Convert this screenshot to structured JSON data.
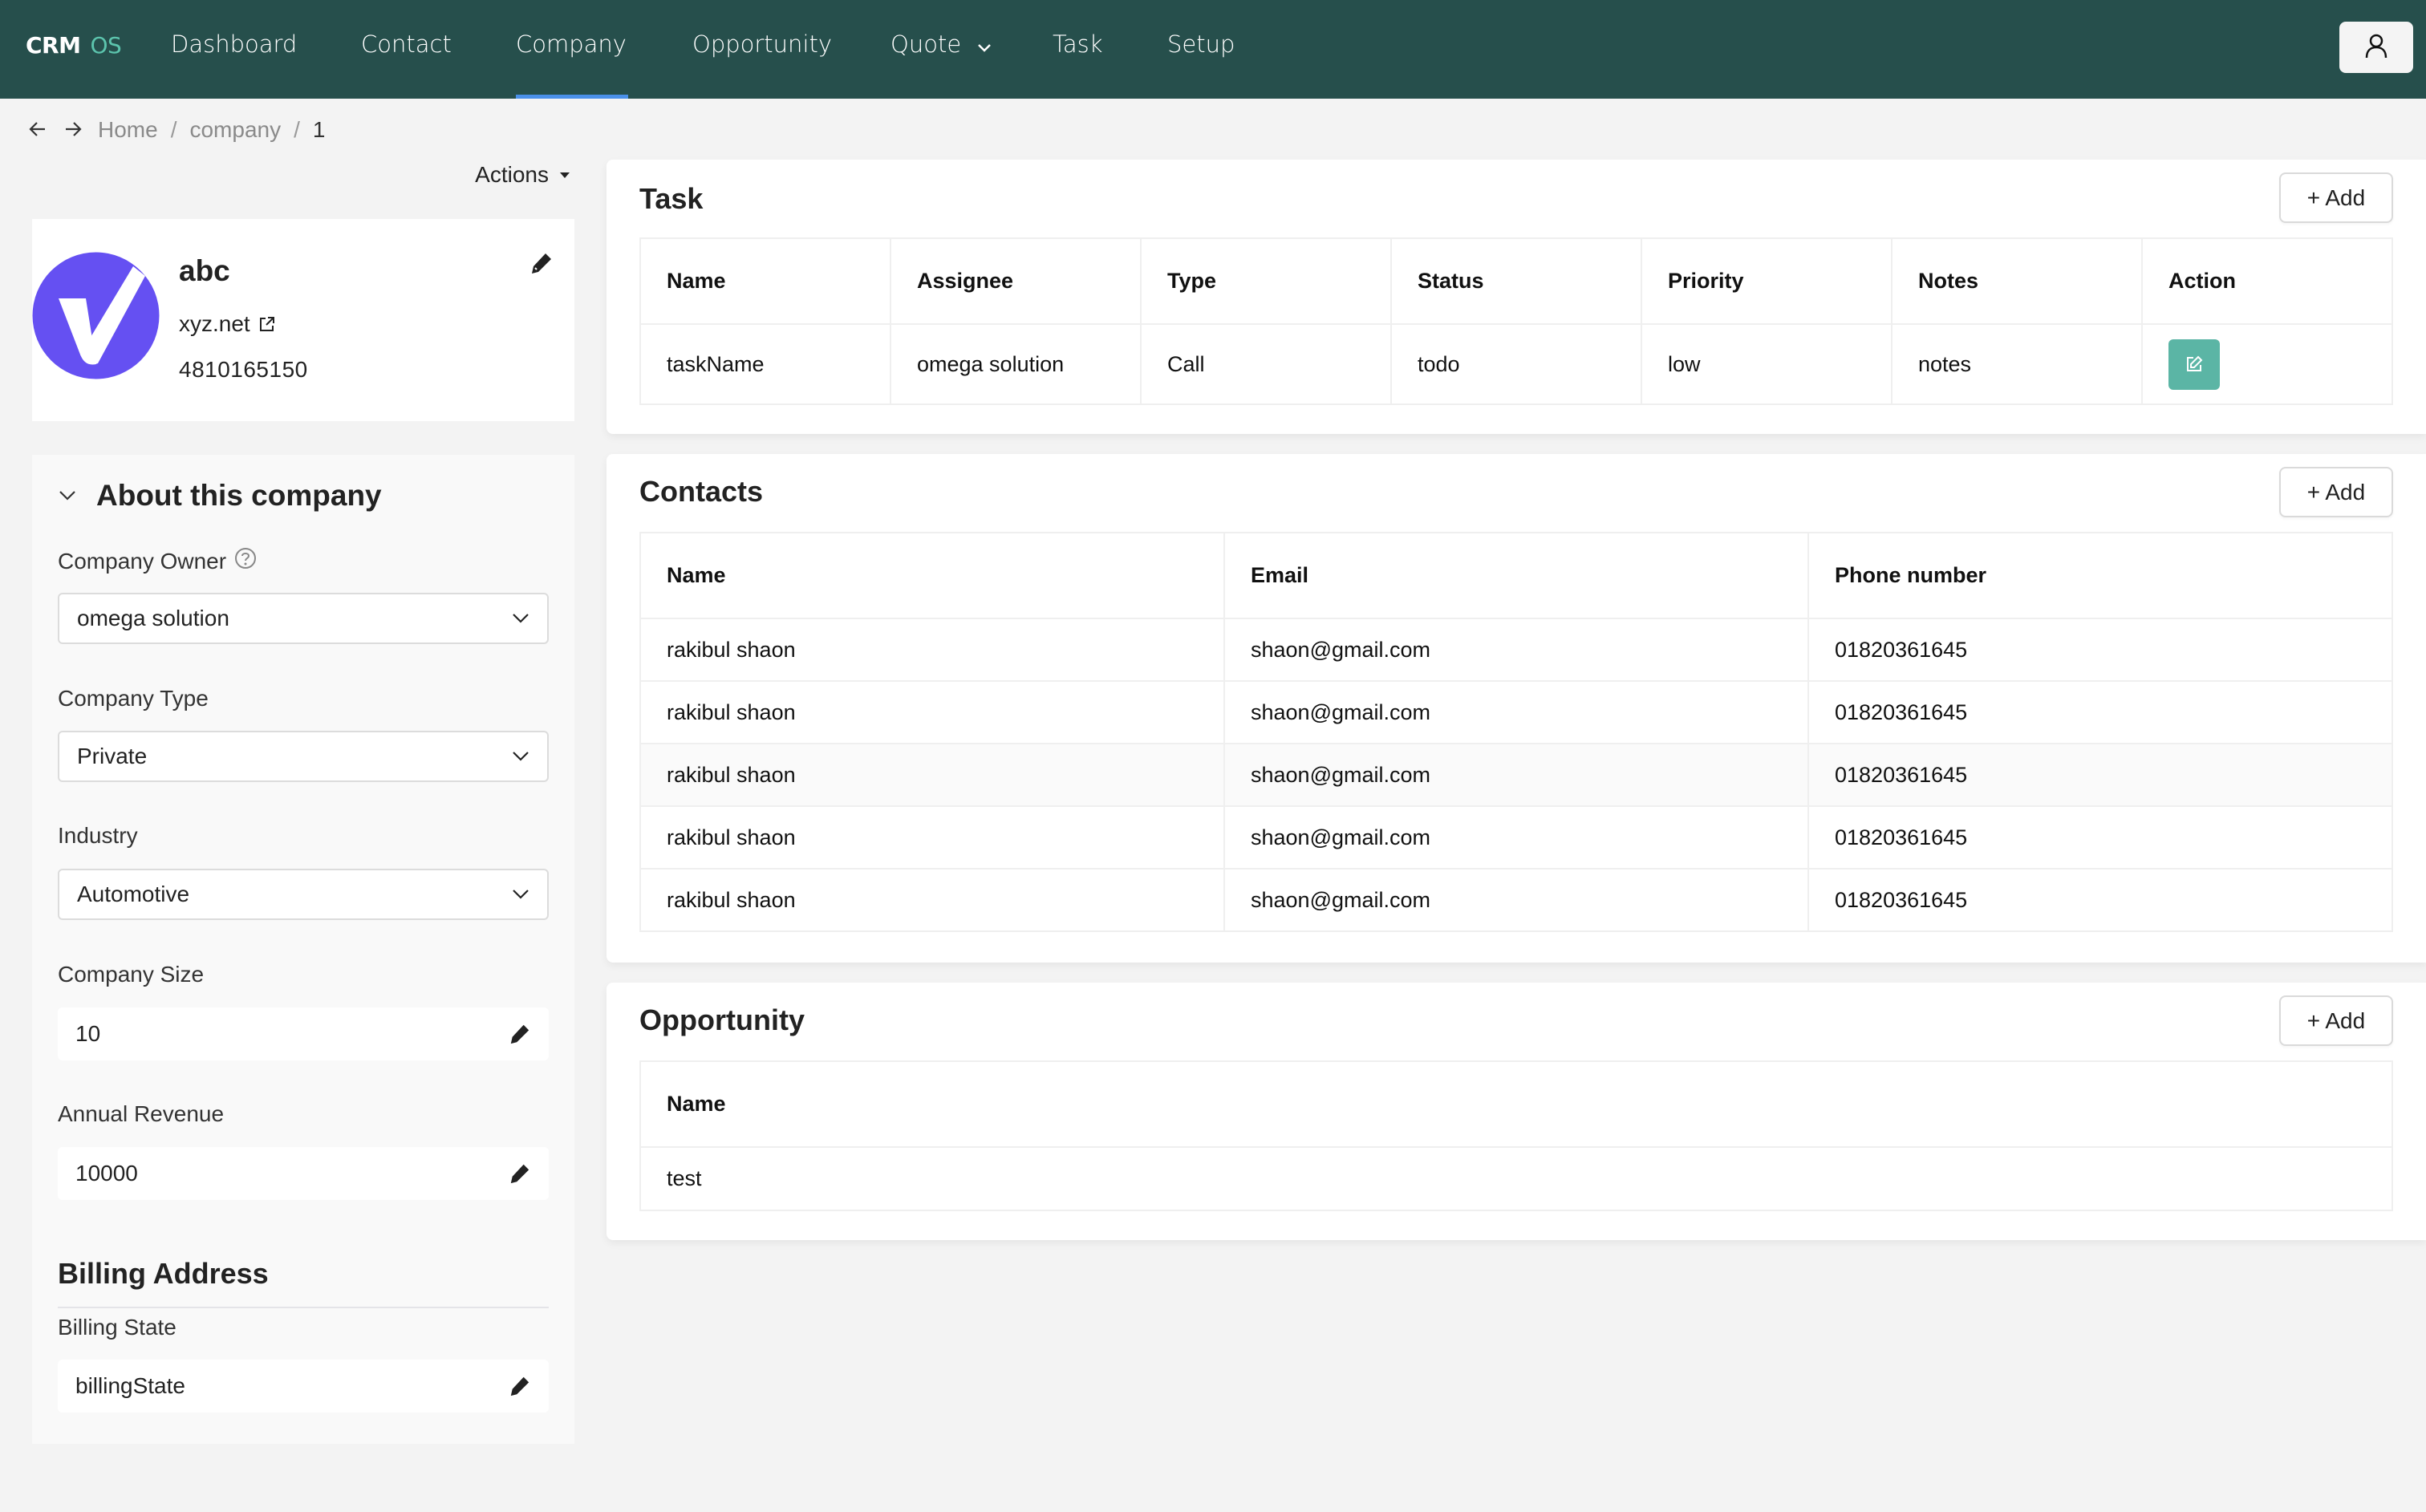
{
  "nav": {
    "logo_main": "CRM",
    "logo_accent": "OS",
    "items": [
      {
        "label": "Dashboard"
      },
      {
        "label": "Contact"
      },
      {
        "label": "Company",
        "active": true
      },
      {
        "label": "Opportunity"
      },
      {
        "label": "Quote",
        "has_dropdown": true
      },
      {
        "label": "Task"
      },
      {
        "label": "Setup"
      }
    ],
    "user_icon": "user-icon"
  },
  "breadcrumb": {
    "items": [
      "Home",
      "company",
      "1"
    ],
    "separator": "/"
  },
  "actions_label": "Actions",
  "company": {
    "name": "abc",
    "website": "xyz.net",
    "phone": "4810165150",
    "logo_color": "#6550f2"
  },
  "about": {
    "title": "About this company",
    "fields": {
      "owner": {
        "label": "Company Owner",
        "value": "omega solution"
      },
      "type": {
        "label": "Company Type",
        "value": "Private"
      },
      "industry": {
        "label": "Industry",
        "value": "Automotive"
      },
      "size": {
        "label": "Company Size",
        "value": "10"
      },
      "revenue": {
        "label": "Annual Revenue",
        "value": "10000"
      }
    },
    "billing": {
      "title": "Billing Address",
      "state": {
        "label": "Billing State",
        "value": "billingState"
      }
    }
  },
  "task": {
    "title": "Task",
    "add_label": "+ Add",
    "columns": [
      "Name",
      "Assignee",
      "Type",
      "Status",
      "Priority",
      "Notes",
      "Action"
    ],
    "rows": [
      {
        "name": "taskName",
        "assignee": "omega solution",
        "type": "Call",
        "status": "todo",
        "priority": "low",
        "notes": "notes"
      }
    ]
  },
  "contacts": {
    "title": "Contacts",
    "add_label": "+ Add",
    "columns": [
      "Name",
      "Email",
      "Phone number"
    ],
    "rows": [
      {
        "name": "rakibul shaon",
        "email": "shaon@gmail.com",
        "phone": "01820361645"
      },
      {
        "name": "rakibul shaon",
        "email": "shaon@gmail.com",
        "phone": "01820361645"
      },
      {
        "name": "rakibul shaon",
        "email": "shaon@gmail.com",
        "phone": "01820361645"
      },
      {
        "name": "rakibul shaon",
        "email": "shaon@gmail.com",
        "phone": "01820361645"
      },
      {
        "name": "rakibul shaon",
        "email": "shaon@gmail.com",
        "phone": "01820361645"
      }
    ]
  },
  "opportunity": {
    "title": "Opportunity",
    "add_label": "+ Add",
    "columns": [
      "Name"
    ],
    "rows": [
      {
        "name": "test"
      }
    ]
  },
  "colors": {
    "nav_bg": "#264f4c",
    "accent_teal": "#5cc4ad",
    "active_underline": "#4a90e8",
    "action_button": "#5bb5a5"
  }
}
